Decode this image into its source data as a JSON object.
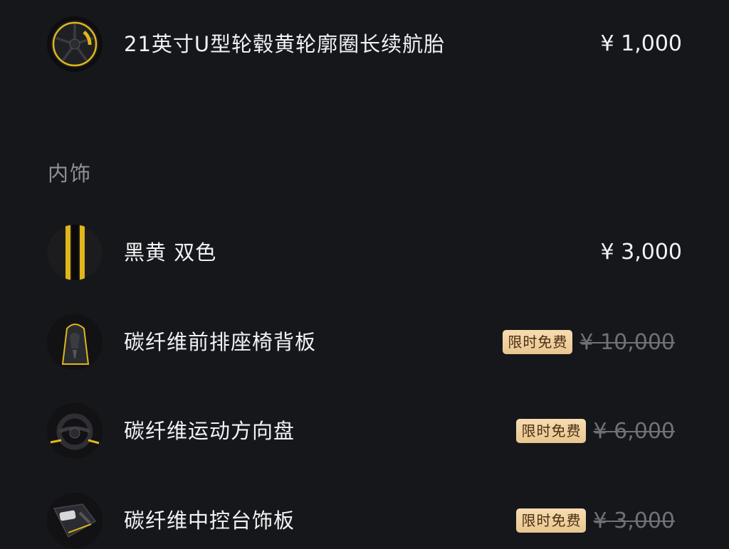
{
  "rows_top": [
    {
      "name": "21英寸U型轮毂黄轮廓圈长续航胎",
      "price": "¥ 1,000",
      "thumb_icon": "wheel-thumbnail-icon"
    }
  ],
  "interior": {
    "section_title": "内饰",
    "items": [
      {
        "name": "黑黄 双色",
        "price": "¥ 3,000",
        "thumb_icon": "black-yellow-two-tone-swatch-icon"
      },
      {
        "name": "碳纤维前排座椅背板",
        "badge": "限时免费",
        "old_price": "¥ 10,000",
        "thumb_icon": "seat-back-thumbnail-icon"
      },
      {
        "name": "碳纤维运动方向盘",
        "badge": "限时免费",
        "old_price": "¥ 6,000",
        "thumb_icon": "steering-wheel-thumbnail-icon"
      },
      {
        "name": "碳纤维中控台饰板",
        "badge": "限时免费",
        "old_price": "¥ 3,000",
        "thumb_icon": "center-console-thumbnail-icon"
      }
    ]
  },
  "colors": {
    "background": "#16171b",
    "accent_yellow": "#e0b61a",
    "badge_bg": "#f2d3a2",
    "badge_text": "#4a2f12",
    "strikethrough_text": "#6f7178",
    "section_title": "#8f9197"
  }
}
